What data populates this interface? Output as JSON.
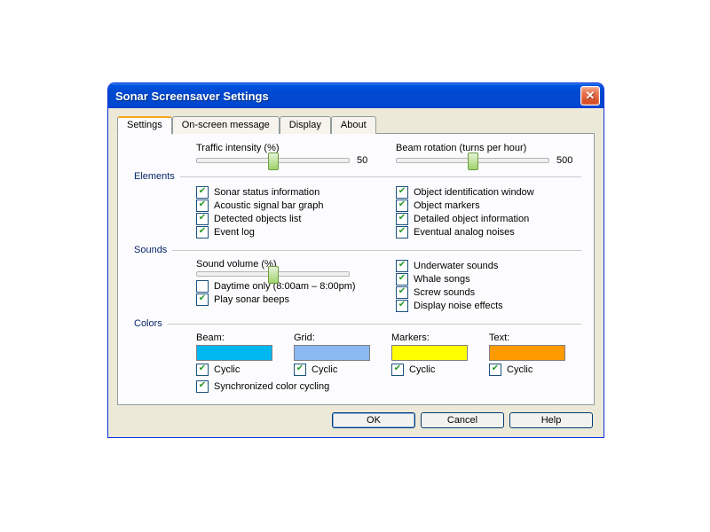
{
  "window": {
    "title": "Sonar Screensaver Settings"
  },
  "tabs": [
    {
      "label": "Settings",
      "active": true
    },
    {
      "label": "On-screen message"
    },
    {
      "label": "Display"
    },
    {
      "label": "About"
    }
  ],
  "sliders": {
    "traffic": {
      "label": "Traffic intensity (%)",
      "value": "50",
      "pos": 50
    },
    "beam": {
      "label": "Beam rotation (turns per hour)",
      "value": "500",
      "pos": 50
    },
    "volume": {
      "label": "Sound volume (%)",
      "pos": 50
    }
  },
  "groups": {
    "elements": "Elements",
    "sounds": "Sounds",
    "colors": "Colors"
  },
  "elements_left": [
    "Sonar status information",
    "Acoustic signal bar graph",
    "Detected objects list",
    "Event log"
  ],
  "elements_right": [
    "Object identification window",
    "Object markers",
    "Detailed object information",
    "Eventual analog noises"
  ],
  "sounds_left": [
    {
      "label": "Daytime only (8:00am – 8:00pm)",
      "checked": false
    },
    {
      "label": "Play sonar beeps",
      "checked": true
    }
  ],
  "sounds_right": [
    "Underwater sounds",
    "Whale songs",
    "Screw sounds",
    "Display noise effects"
  ],
  "colors": [
    {
      "name": "Beam:",
      "hex": "#00b7f0",
      "cyclic": "Cyclic"
    },
    {
      "name": "Grid:",
      "hex": "#8ab8f0",
      "cyclic": "Cyclic"
    },
    {
      "name": "Markers:",
      "hex": "#ffff00",
      "cyclic": "Cyclic"
    },
    {
      "name": "Text:",
      "hex": "#ff9a00",
      "cyclic": "Cyclic"
    }
  ],
  "sync_colors": "Synchronized color cycling",
  "buttons": {
    "ok": "OK",
    "cancel": "Cancel",
    "help": "Help"
  }
}
